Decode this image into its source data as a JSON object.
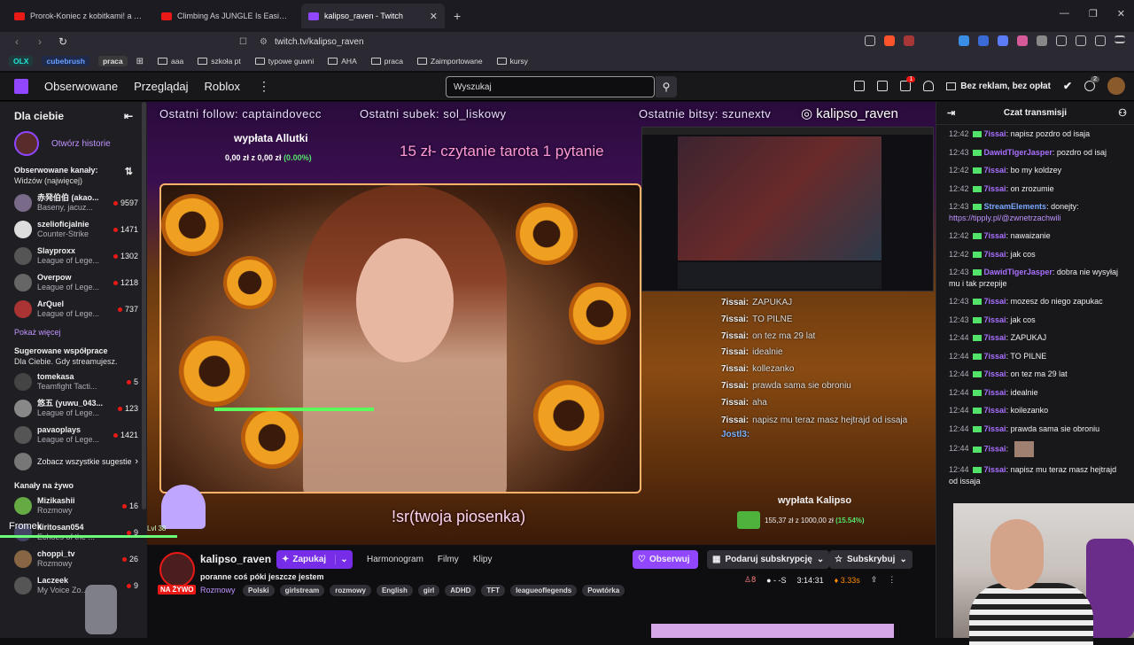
{
  "browser": {
    "tabs": [
      {
        "title": "Prorok-Koniec z kobitkami! a może n",
        "color": "#e91916",
        "active": false
      },
      {
        "title": "Climbing As JUNGLE Is Easier Than Y",
        "color": "#e91916",
        "active": false
      },
      {
        "title": "kalipso_raven - Twitch",
        "color": "#9146ff",
        "active": true
      }
    ],
    "url": "twitch.tv/kalipso_raven",
    "bookmarks": [
      {
        "label": "OLX",
        "color": "#23e5db"
      },
      {
        "label": "cubebrush",
        "color": "#6aa0ff"
      },
      {
        "label": "praca",
        "color": "#bbbbbb"
      }
    ],
    "folders": [
      "aaa",
      "szkoła pt",
      "typowe guwni",
      "AHA",
      "praca",
      "Zaimportowane",
      "kursy"
    ]
  },
  "twitch_nav": {
    "links": [
      "Obserwowane",
      "Przeglądaj",
      "Roblox"
    ],
    "search_placeholder": "Wyszukaj",
    "prime_label": "Bez reklam, bez opłat",
    "notif_count": "1",
    "drops_count": "2"
  },
  "sidebar": {
    "title": "Dla ciebie",
    "stories": "Otwórz historie",
    "followed_title": "Obserwowane kanały:",
    "followed_sub": "Widzów (najwięcej)",
    "followed": [
      {
        "name": "赤発伯伯 (akao...",
        "game": "Baseny, jacuz...",
        "viewers": "9597",
        "color": "#7a6a8a"
      },
      {
        "name": "szelioficjalnie",
        "game": "Counter-Strike",
        "viewers": "1471",
        "color": "#ddd"
      },
      {
        "name": "Slayproxx",
        "game": "League of Lege...",
        "viewers": "1302",
        "color": "#555"
      },
      {
        "name": "Overpow",
        "game": "League of Lege...",
        "viewers": "1218",
        "color": "#666"
      },
      {
        "name": "ArQuel",
        "game": "League of Lege...",
        "viewers": "737",
        "color": "#a33"
      }
    ],
    "show_more": "Pokaż więcej",
    "suggested_title": "Sugerowane współprace",
    "suggested_sub": "Dla Ciebie. Gdy streamujesz.",
    "suggested": [
      {
        "name": "tomekasa",
        "game": "Teamfight Tacti...",
        "viewers": "5",
        "color": "#444"
      },
      {
        "name": "悠五 (yuwu_043...",
        "game": "League of Lege...",
        "viewers": "123",
        "color": "#888"
      },
      {
        "name": "pavaoplays",
        "game": "League of Lege...",
        "viewers": "1421",
        "color": "#555"
      }
    ],
    "see_all": "Zobacz wszystkie sugestie",
    "live_title": "Kanały na żywo",
    "live": [
      {
        "name": "Mizikashii",
        "game": "Rozmowy",
        "viewers": "16",
        "color": "#6a4"
      },
      {
        "name": "kiritosan054",
        "game": "Echoes of the ...",
        "viewers": "9",
        "color": "#446"
      },
      {
        "name": "choppi_tv",
        "game": "Rozmowy",
        "viewers": "26",
        "color": "#864"
      },
      {
        "name": "Laczeek",
        "game": "My Voice Zo...",
        "viewers": "9",
        "color": "#555"
      }
    ]
  },
  "stream_overlay": {
    "last_follow": "Ostatni follow: captaindovecc",
    "last_sub": "Ostatni subek: sol_liskowy",
    "last_bits": "Ostatnie bitsy: szunextv",
    "instagram": "kalipso_raven",
    "goal1_title": "wypłata Allutki",
    "goal1_value": "0,00 zł z 0,00 zł",
    "goal1_pct": "(0.00%)",
    "tarot": "15 zł- czytanie tarota 1 pytanie",
    "sr": "!sr(twoja piosenka)",
    "goal2_title": "wypłata Kalipso",
    "goal2_value": "155,37 zł z 1000,00 zł",
    "goal2_pct": "(15.54%)",
    "ghost_name": "Fromek",
    "ghost_lvl": "Lvl 38",
    "chat_overlay": [
      {
        "user": "7issai:",
        "text": "ZAPUKAJ"
      },
      {
        "user": "7issai:",
        "text": "TO PILNE"
      },
      {
        "user": "7issai:",
        "text": "on tez ma 29 lat"
      },
      {
        "user": "7issai:",
        "text": "idealnie"
      },
      {
        "user": "7issai:",
        "text": "kollezanko"
      },
      {
        "user": "7issai:",
        "text": "prawda sama sie obroniu"
      },
      {
        "user": "7issai:",
        "text": "aha"
      },
      {
        "user": "7issai:",
        "text": "napisz mu teraz masz hejtrajd od issaja"
      },
      {
        "user": "Jostl3:",
        "text": ""
      }
    ]
  },
  "channel": {
    "name": "kalipso_raven",
    "live_label": "NA ŻYWO",
    "knock_label": "Zapukaj",
    "tabs": [
      "Harmonogram",
      "Filmy",
      "Klipy"
    ],
    "follow_label": "Obserwuj",
    "gift_label": "Podaruj subskrypcję",
    "subscribe_label": "Subskrybuj",
    "title": "poranne coś póki jeszcze jestem",
    "category": "Rozmowy",
    "tags": [
      "Polski",
      "girlstream",
      "rozmowy",
      "English",
      "girl",
      "ADHD",
      "TFT",
      "leagueoflegends",
      "Powtórka"
    ],
    "viewers": "8",
    "rating": "- -S",
    "uptime": "3:14:31",
    "bits": "3.33s"
  },
  "chat": {
    "title": "Czat transmisji",
    "messages": [
      {
        "ts": "12:42",
        "user": "7issai",
        "color": "#a970ff",
        "text": "napisz pozdro od isaja"
      },
      {
        "ts": "12:43",
        "user": "DawidTigerJasper",
        "color": "#a970ff",
        "text": "pozdro od isaj"
      },
      {
        "ts": "12:42",
        "user": "7issai",
        "color": "#a970ff",
        "text": "bo my koldzey"
      },
      {
        "ts": "12:42",
        "user": "7issai",
        "color": "#a970ff",
        "text": "on zrozumie"
      },
      {
        "ts": "12:43",
        "user": "StreamElements",
        "color": "#7aa7ff",
        "text": "donejty:",
        "link": "https://tipply.pl/@zwnetrzachwili"
      },
      {
        "ts": "12:42",
        "user": "7issai",
        "color": "#a970ff",
        "text": "nawaizanie"
      },
      {
        "ts": "12:42",
        "user": "7issai",
        "color": "#a970ff",
        "text": "jak cos"
      },
      {
        "ts": "12:43",
        "user": "DawidTigerJasper",
        "color": "#a970ff",
        "text": "dobra nie wysyłaj mu i tak przepije"
      },
      {
        "ts": "12:43",
        "user": "7issai",
        "color": "#a970ff",
        "text": "mozesz do niego zapukac"
      },
      {
        "ts": "12:43",
        "user": "7issai",
        "color": "#a970ff",
        "text": "jak cos"
      },
      {
        "ts": "12:44",
        "user": "7issai",
        "color": "#a970ff",
        "text": "ZAPUKAJ"
      },
      {
        "ts": "12:44",
        "user": "7issai",
        "color": "#a970ff",
        "text": "TO PILNE"
      },
      {
        "ts": "12:44",
        "user": "7issai",
        "color": "#a970ff",
        "text": "on tez ma 29 lat"
      },
      {
        "ts": "12:44",
        "user": "7issai",
        "color": "#a970ff",
        "text": "idealnie"
      },
      {
        "ts": "12:44",
        "user": "7issai",
        "color": "#a970ff",
        "text": "koilezanko"
      },
      {
        "ts": "12:44",
        "user": "7issai",
        "color": "#a970ff",
        "text": "prawda sama sie obroniu"
      },
      {
        "ts": "12:44",
        "user": "7issai",
        "color": "#a970ff",
        "text": ""
      },
      {
        "ts": "12:44",
        "user": "7issai",
        "color": "#a970ff",
        "text": "napisz mu teraz masz hejtrajd od issaja"
      }
    ]
  }
}
